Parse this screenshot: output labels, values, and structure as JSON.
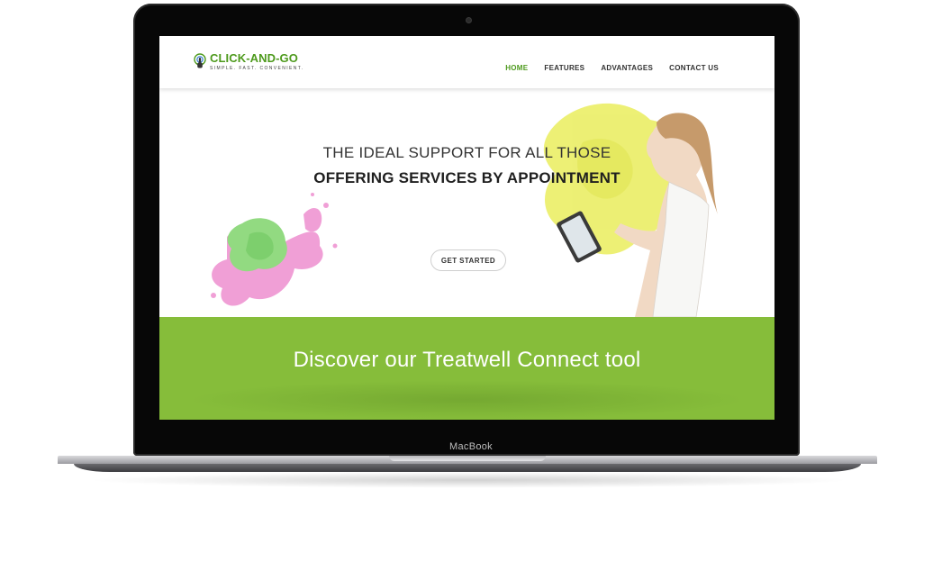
{
  "device": {
    "label": "MacBook"
  },
  "site": {
    "logo": {
      "name": "CLICK-AND-GO",
      "tagline": "SIMPLE. FAST. CONVENIENT.",
      "icon": "pointer-hand-icon"
    },
    "nav": {
      "items": [
        {
          "label": "HOME",
          "active": true
        },
        {
          "label": "FEATURES",
          "active": false
        },
        {
          "label": "ADVANTAGES",
          "active": false
        },
        {
          "label": "CONTACT US",
          "active": false
        }
      ]
    },
    "hero": {
      "line1": "THE IDEAL SUPPORT FOR ALL THOSE",
      "line2": "OFFERING SERVICES BY APPOINTMENT",
      "cta_label": "GET STARTED"
    },
    "band": {
      "title": "Discover our Treatwell Connect tool"
    }
  },
  "colors": {
    "brand_green": "#4e9a1d",
    "band_green": "#86bd3a",
    "splash_pink": "#e86bb8",
    "splash_yellow": "#e6ea3a"
  }
}
